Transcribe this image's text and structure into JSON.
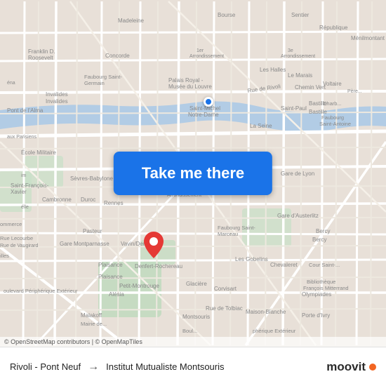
{
  "map": {
    "attribution": "© OpenStreetMap contributors | © OpenMapTiles",
    "origin_dot": {
      "description": "origin location marker"
    },
    "destination_marker": {
      "description": "destination pin"
    }
  },
  "button": {
    "label": "Take me there"
  },
  "route": {
    "from": "Rivoli - Pont Neuf",
    "arrow": "→",
    "to": "Institut Mutualiste Montsouris"
  },
  "branding": {
    "name": "moovit",
    "colors": {
      "blue": "#1a73e8",
      "orange": "#f26522"
    }
  }
}
